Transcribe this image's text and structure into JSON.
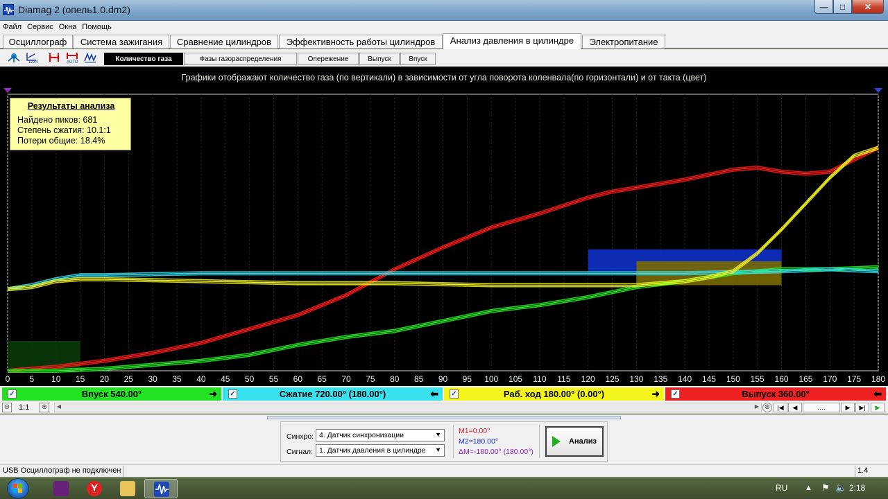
{
  "window": {
    "title": "Diamag 2 (опель1.0.dm2)",
    "controls": {
      "minimize": "—",
      "maximize": "□",
      "close": "✕"
    }
  },
  "menu": [
    "Файл",
    "Сервис",
    "Окна",
    "Помощь"
  ],
  "tabs": [
    "Осциллограф",
    "Система зажигания",
    "Сравнение цилиндров",
    "Эффективность работы цилиндров",
    "Анализ давления в цилиндре",
    "Электропитание"
  ],
  "active_tab": "Анализ давления в цилиндре",
  "subtabs": [
    "Количество газа",
    "Фазы газораспределения",
    "Опережение",
    "Выпуск",
    "Впуск"
  ],
  "active_subtab": "Количество газа",
  "toolbar_icons": [
    "network-icon",
    "scale-1234-icon",
    "marker-icon",
    "auto-scale-icon",
    "waveform-icon"
  ],
  "chart_caption": "Графики отображают количество газа (по вертикали) в зависимости от угла поворота коленвала(по горизонтали) и от такта (цвет)",
  "results": {
    "title": "Результаты анализа",
    "lines": [
      "Найдено пиков: 681",
      "Степень сжатия: 10.1:1",
      "Потери общие: 18.4%"
    ]
  },
  "chart_data": {
    "type": "line",
    "title": "",
    "xlabel": "",
    "ylabel": "",
    "x_ticks": [
      0,
      5,
      10,
      15,
      20,
      25,
      30,
      35,
      40,
      45,
      50,
      55,
      60,
      65,
      70,
      75,
      80,
      85,
      90,
      95,
      100,
      105,
      110,
      115,
      120,
      125,
      130,
      135,
      140,
      145,
      150,
      155,
      160,
      165,
      170,
      175,
      180
    ],
    "xlim": [
      0,
      180
    ],
    "ylim": [
      0,
      1
    ],
    "grid": true,
    "series": [
      {
        "color": "#ff1a1a",
        "x": [
          0,
          10,
          20,
          30,
          40,
          50,
          60,
          70,
          80,
          90,
          100,
          110,
          120,
          125,
          130,
          140,
          150,
          155,
          160,
          165,
          170,
          175,
          180
        ],
        "y": [
          0.0,
          0.02,
          0.05,
          0.09,
          0.14,
          0.21,
          0.28,
          0.38,
          0.51,
          0.62,
          0.72,
          0.79,
          0.87,
          0.9,
          0.92,
          0.96,
          1.01,
          1.02,
          1.0,
          0.99,
          1.0,
          1.06,
          1.12
        ]
      },
      {
        "color": "#22ee22",
        "x": [
          0,
          10,
          20,
          30,
          40,
          50,
          60,
          70,
          80,
          90,
          100,
          110,
          120,
          130,
          140,
          150,
          160,
          170,
          180
        ],
        "y": [
          0.0,
          0.0,
          0.01,
          0.03,
          0.05,
          0.08,
          0.13,
          0.17,
          0.2,
          0.25,
          0.3,
          0.33,
          0.37,
          0.42,
          0.45,
          0.49,
          0.51,
          0.51,
          0.52
        ]
      },
      {
        "color": "#33ddee",
        "x": [
          0,
          5,
          10,
          15,
          20,
          40,
          60,
          80,
          100,
          120,
          140,
          160,
          170,
          180
        ],
        "y": [
          0.41,
          0.43,
          0.46,
          0.48,
          0.48,
          0.49,
          0.49,
          0.49,
          0.49,
          0.49,
          0.49,
          0.5,
          0.51,
          0.5
        ]
      },
      {
        "color": "#f0f020",
        "x": [
          0,
          5,
          10,
          15,
          20,
          40,
          60,
          80,
          100,
          120,
          130,
          140,
          145,
          150,
          155,
          160,
          165,
          170,
          175,
          180
        ],
        "y": [
          0.41,
          0.42,
          0.45,
          0.46,
          0.46,
          0.45,
          0.44,
          0.44,
          0.43,
          0.43,
          0.43,
          0.45,
          0.47,
          0.5,
          0.59,
          0.71,
          0.84,
          0.97,
          1.08,
          1.12
        ]
      }
    ],
    "regions": [
      {
        "color": "#0a3a0a",
        "x": [
          0,
          15
        ],
        "y": [
          0,
          0.15
        ]
      },
      {
        "color": "#1030c8",
        "x": [
          120,
          160
        ],
        "y": [
          0.5,
          0.61
        ]
      },
      {
        "color": "#7a6a00",
        "x": [
          130,
          160
        ],
        "y": [
          0.43,
          0.55
        ]
      }
    ]
  },
  "strokes": [
    {
      "label": "Впуск 540.00°",
      "color": "#22e222",
      "arrow": "➜"
    },
    {
      "label": "Сжатие 720.00° (180.00°)",
      "color": "#38e1ee",
      "arrow": "⬅"
    },
    {
      "label": "Раб. ход 180.00° (0.00°)",
      "color": "#f5f51e",
      "arrow": "➜"
    },
    {
      "label": "Выпуск 360.00°",
      "color": "#ee2222",
      "arrow": "⬅"
    }
  ],
  "zoom": {
    "label": "1:1",
    "minus": "⊖",
    "plus": "⊕",
    "page": "...."
  },
  "controls": {
    "sync_label": "Синхро:",
    "sync_value": "4.  Датчик синхронизации",
    "signal_label": "Сигнал:",
    "signal_value": "1.  Датчик давления в цилиндре",
    "m1": "M1=0.00°",
    "m2": "M2=180.00°",
    "dm": "ΔM=-180.00° (180.00°)",
    "analyze": "Анализ"
  },
  "status": {
    "text": "USB Осциллограф не подключен",
    "version": "1.4"
  },
  "taskbar": {
    "lang": "RU",
    "time": "2:18"
  }
}
